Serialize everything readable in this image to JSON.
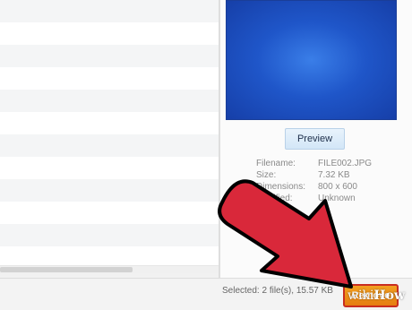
{
  "file_list": {
    "row_count": 11
  },
  "preview": {
    "image_alt": "blue gradient thumbnail",
    "button_label": "Preview",
    "fields": [
      {
        "label": "Filename:",
        "value": "FILE002.JPG"
      },
      {
        "label": "Size:",
        "value": "7.32 KB"
      },
      {
        "label": "Dimensions:",
        "value": "800 x 600"
      },
      {
        "label": "Modified:",
        "value": "Unknown"
      }
    ]
  },
  "status_bar": {
    "selection_text": "Selected: 2 file(s), 15.57 KB",
    "remove_label": "Remove"
  },
  "watermark": {
    "prefix": "wiki",
    "suffix": "How"
  },
  "colors": {
    "arrow_fill": "#d9283a",
    "remove_button": "#e67d11",
    "remove_border": "#c92d20",
    "preview_image": "#1f56c9"
  }
}
